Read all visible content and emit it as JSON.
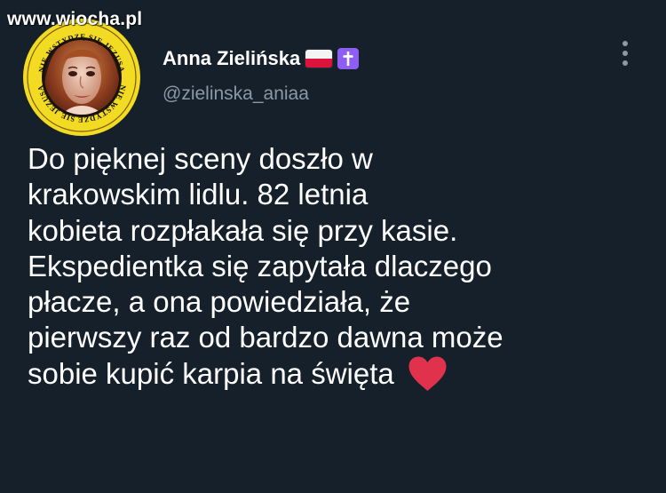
{
  "watermark": {
    "text": "www.wiocha.pl"
  },
  "author": {
    "display_name": "Anna Zielińska",
    "handle": "@zielinska_aniaa",
    "avatar_badge_text_top": "NIE WSTYDZĘ SIĘ JEZUSA",
    "avatar_badge_text_bottom": "NIE WSTYDZĘ SIĘ JEZUSA",
    "flag_icon": "poland-flag-icon",
    "cross_icon": "latin-cross-icon"
  },
  "tweet": {
    "lines": [
      "Do pięknej sceny doszło w",
      "krakowskim lidlu. 82 letnia",
      "kobieta rozpłakała się przy kasie.",
      "Ekspedientka się zapytała dlaczego",
      "płacze, a ona powiedziała, że",
      "pierwszy raz od bardzo dawna może",
      "sobie kupić karpia na święta"
    ],
    "emoji_icon": "red-heart-icon"
  },
  "actions": {
    "more_icon": "vertical-ellipsis-icon"
  },
  "colors": {
    "background": "#15202b",
    "text_primary": "#ffffff",
    "text_secondary": "#8b98a5",
    "badge_yellow": "#f2db22",
    "heart": "#e0314d",
    "cross_badge": "#8e5ef2"
  }
}
